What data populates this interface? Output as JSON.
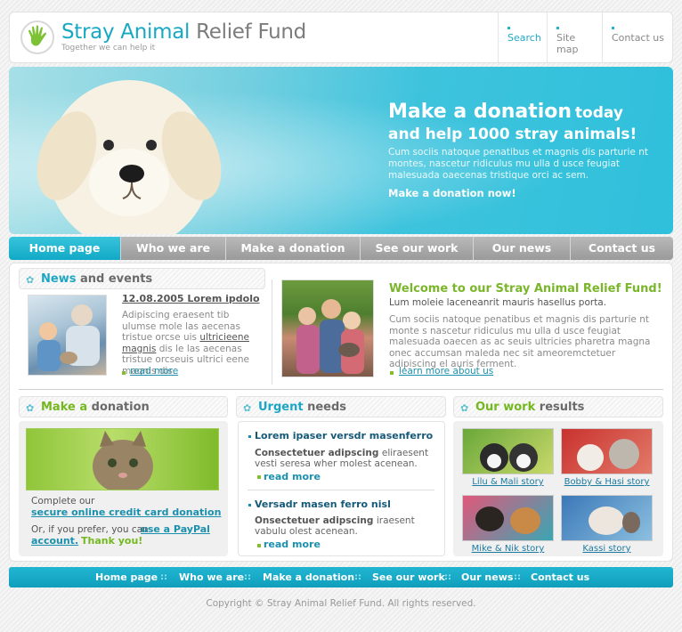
{
  "header": {
    "title_part1": "Stray Animal",
    "title_part2": "Relief Fund",
    "tagline": "Together we can help it",
    "links": [
      "Search",
      "Site map",
      "Contact us"
    ]
  },
  "banner": {
    "title_line1_main": "Make a donation",
    "title_line1_small": "today",
    "title_line2": "and help 1000 stray animals!",
    "text": "Cum sociis natoque penatibus et magnis dis parturie nt montes, nascetur ridiculus mu ulla d usce feugiat malesuada oaecenas tristique orci ac sem.",
    "cta": "Make a donation now!"
  },
  "nav": [
    "Home page",
    "Who we are",
    "Make a donation",
    "See our work",
    "Our news",
    "Contact us"
  ],
  "news": {
    "heading_hl": "News",
    "heading_rest": "and events",
    "date_title": "12.08.2005 Lorem ipdolo",
    "text_before": "Adipiscing eraesent tib ulumse mole las aecenas tristue orcse uis",
    "text_link": "ultricieene magnis",
    "text_after": "dis le las aecenas tristue orcseuis ultrici eene magnis dis..",
    "read_more": "read more"
  },
  "welcome": {
    "title": "Welcome to our Stray Animal Relief Fund!",
    "lead": "Lum moleie laceneanrit mauris hasellus porta.",
    "text": "Cum sociis natoque penatibus et magnis dis parturie nt monte s nascetur ridiculus mu ulla d usce feugiat malesuada oaecen as ac seuis ultricies pharetra magna onec accumsan maleda nec sit ameoremctetuer adipiscing el auris ferment.",
    "link": "learn more about us"
  },
  "donation": {
    "heading_hl": "Make a",
    "heading_rest": "donation",
    "text1": "Complete our",
    "link1": "secure online credit card donation",
    "text2": "Or, if you prefer, you can",
    "link2": "use a PayPal",
    "link3": "account.",
    "thanks": "Thank you!"
  },
  "urgent": {
    "heading_hl": "Urgent",
    "heading_rest": "needs",
    "items": [
      {
        "title": "Lorem ipaser versdr masenferro",
        "sub": "Consectetuer adipscing",
        "text1": "eliraesent",
        "text2": "vesti seresa wher molest acenean.",
        "more": "read more"
      },
      {
        "title": "Versadr masen ferro nisl",
        "sub": "Onsectetuer adipscing",
        "text1": "iraesent",
        "text2": "vabulu olest acenean.",
        "more": "read more"
      }
    ]
  },
  "results": {
    "heading_hl": "Our work",
    "heading_rest": "results",
    "stories": [
      "Lilu & Mali story",
      "Bobby & Hasi story",
      "Mike & Nik story",
      "Kassi story"
    ]
  },
  "footer": {
    "nav": [
      "Home page",
      "Who we are",
      "Make a donation",
      "See our work",
      "Our news",
      "Contact us"
    ],
    "separator": "::",
    "copyright": "Copyright © Stray Animal Relief Fund. All rights reserved."
  },
  "colors": {
    "accent": "#1da6c3",
    "green": "#74b820",
    "nav_gray": "#a8a8a8"
  }
}
